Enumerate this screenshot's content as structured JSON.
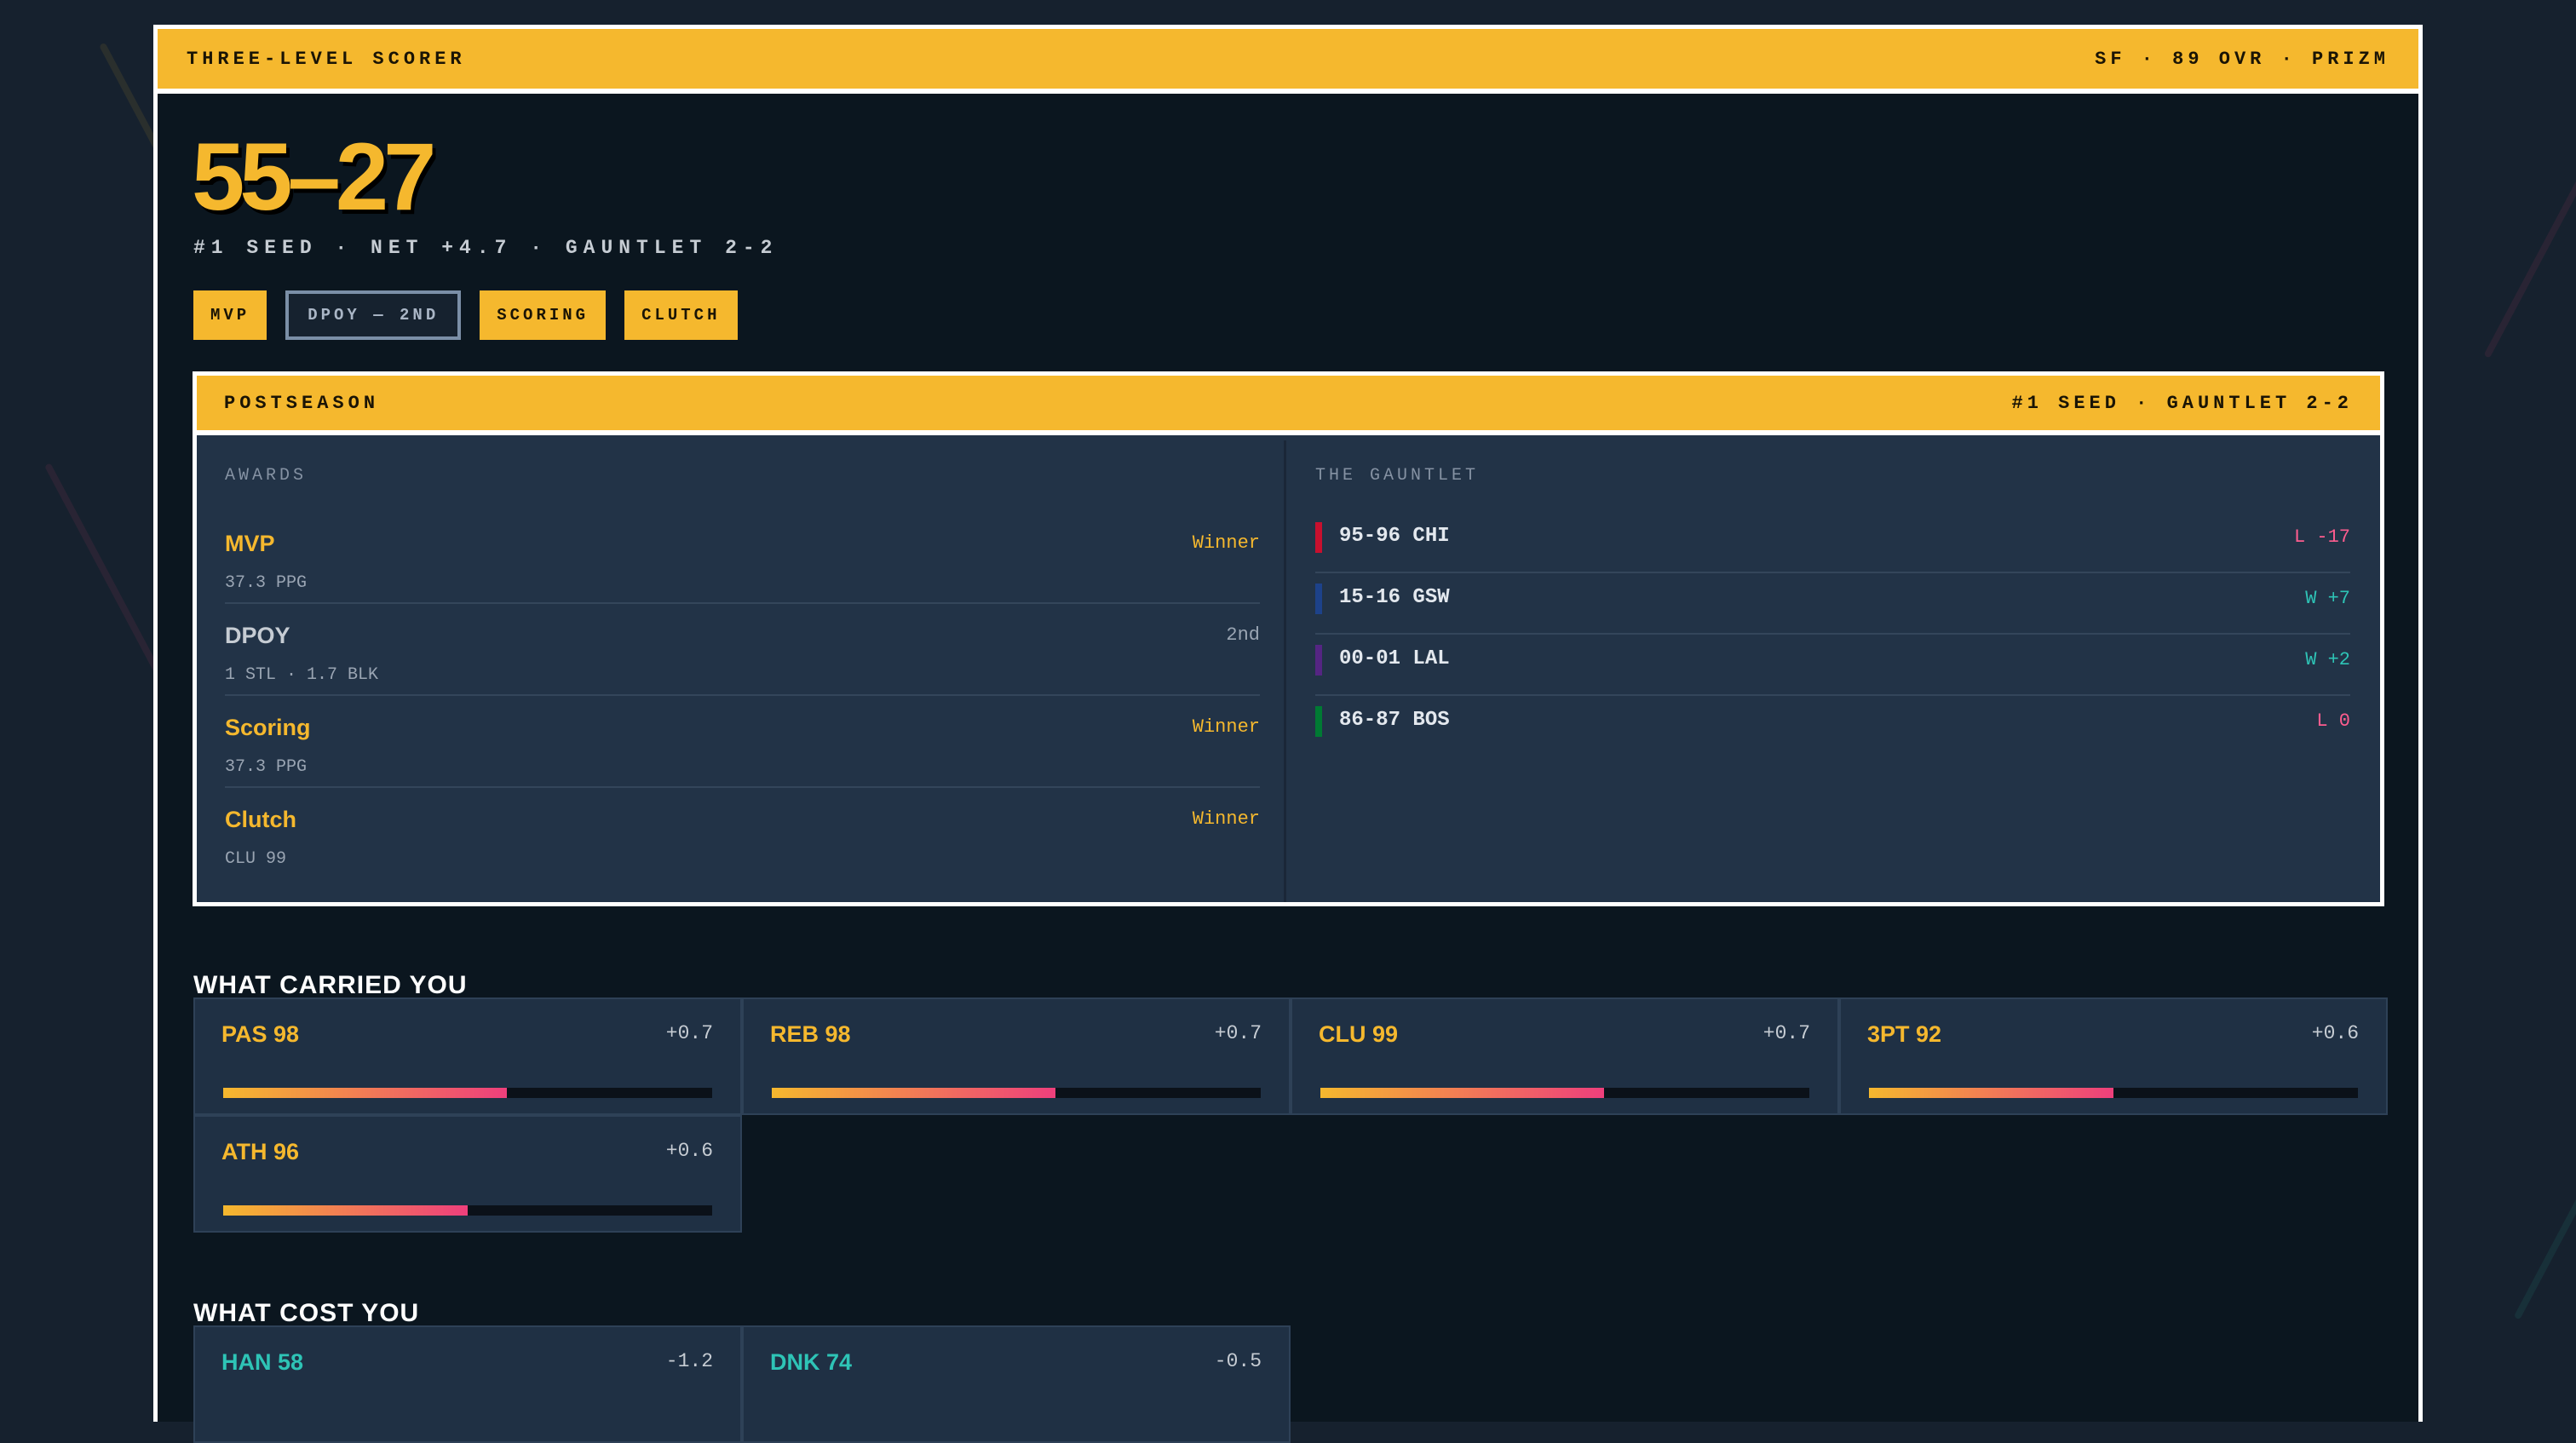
{
  "header": {
    "title": "THREE-LEVEL SCORER",
    "meta": "SF · 89 OVR · PRIZM"
  },
  "record": {
    "value": "55–27",
    "subtitle": "#1 SEED · NET +4.7 · GAUNTLET 2-2"
  },
  "badges": [
    {
      "label": "MVP",
      "style": "filled"
    },
    {
      "label": "DPOY — 2ND",
      "style": "outline"
    },
    {
      "label": "SCORING",
      "style": "filled"
    },
    {
      "label": "CLUTCH",
      "style": "filled"
    }
  ],
  "postseason": {
    "title": "POSTSEASON",
    "summary": "#1 SEED · GAUNTLET 2-2",
    "awards_label": "AWARDS",
    "awards": [
      {
        "name": "MVP",
        "stat": "37.3 PPG",
        "result": "Winner",
        "won": true
      },
      {
        "name": "DPOY",
        "stat": "1 STL · 1.7 BLK",
        "result": "2nd",
        "won": false
      },
      {
        "name": "Scoring",
        "stat": "37.3 PPG",
        "result": "Winner",
        "won": true
      },
      {
        "name": "Clutch",
        "stat": "CLU 99",
        "result": "Winner",
        "won": true
      }
    ],
    "gauntlet_label": "THE GAUNTLET",
    "gauntlet": [
      {
        "team": "95-96 CHI",
        "result": "L -17",
        "win": false,
        "color": "#c8102e"
      },
      {
        "team": "15-16 GSW",
        "result": "W +7",
        "win": true,
        "color": "#1d428a"
      },
      {
        "team": "00-01 LAL",
        "result": "W +2",
        "win": true,
        "color": "#552583"
      },
      {
        "team": "86-87 BOS",
        "result": "L 0",
        "win": false,
        "color": "#007a33"
      }
    ]
  },
  "carried": {
    "title": "WHAT CARRIED YOU",
    "items": [
      {
        "label": "PAS 98",
        "delta": "+0.7",
        "level": 0.58
      },
      {
        "label": "REB 98",
        "delta": "+0.7",
        "level": 0.58
      },
      {
        "label": "CLU 99",
        "delta": "+0.7",
        "level": 0.58
      },
      {
        "label": "3PT 92",
        "delta": "+0.6",
        "level": 0.5
      },
      {
        "label": "ATH 96",
        "delta": "+0.6",
        "level": 0.5
      }
    ]
  },
  "cost": {
    "title": "WHAT COST YOU",
    "items": [
      {
        "label": "HAN 58",
        "delta": "-1.2"
      },
      {
        "label": "DNK 74",
        "delta": "-0.5"
      }
    ]
  },
  "colors": {
    "accent": "#f5b82e",
    "win": "#2ec4b6",
    "loss": "#ff5d8f",
    "cost": "#2ec4b6"
  }
}
